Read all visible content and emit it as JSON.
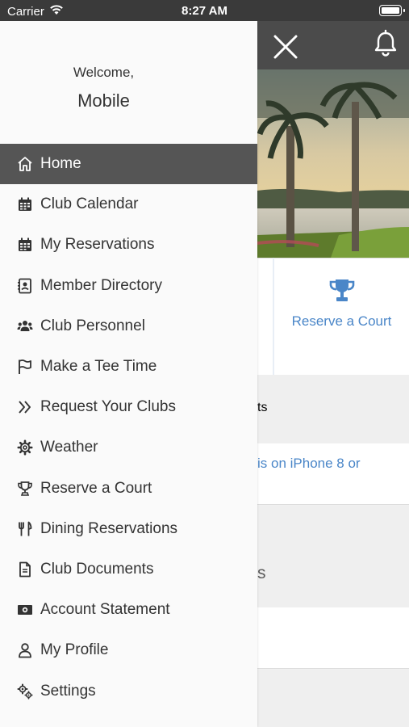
{
  "status_bar": {
    "carrier": "Carrier",
    "time": "8:27 AM"
  },
  "header": {
    "close_icon": "close-icon",
    "bell_icon": "bell-icon"
  },
  "background": {
    "tile_label": "Reserve a Court",
    "tile_icon": "trophy-icon",
    "section1_fragment": "ts",
    "link_fragment": "is on iPhone 8 or",
    "section2_fragment": "s"
  },
  "drawer": {
    "welcome": "Welcome,",
    "username": "Mobile",
    "menu": [
      {
        "label": "Home",
        "icon": "home-icon",
        "active": true
      },
      {
        "label": "Club Calendar",
        "icon": "calendar-icon"
      },
      {
        "label": "My Reservations",
        "icon": "calendar-icon"
      },
      {
        "label": "Member Directory",
        "icon": "contact-book-icon"
      },
      {
        "label": "Club Personnel",
        "icon": "users-icon"
      },
      {
        "label": "Make a Tee Time",
        "icon": "flag-icon"
      },
      {
        "label": "Request Your Clubs",
        "icon": "double-chevron-icon"
      },
      {
        "label": "Weather",
        "icon": "gear-icon"
      },
      {
        "label": "Reserve a Court",
        "icon": "trophy-icon"
      },
      {
        "label": "Dining Reservations",
        "icon": "utensils-icon"
      },
      {
        "label": "Club Documents",
        "icon": "document-icon"
      },
      {
        "label": "Account Statement",
        "icon": "money-icon"
      },
      {
        "label": "My Profile",
        "icon": "user-icon"
      },
      {
        "label": "Settings",
        "icon": "gears-icon"
      }
    ]
  },
  "colors": {
    "header_bg": "#4b4b4b",
    "active_item_bg": "#555555",
    "accent_blue": "#4a86c8"
  }
}
